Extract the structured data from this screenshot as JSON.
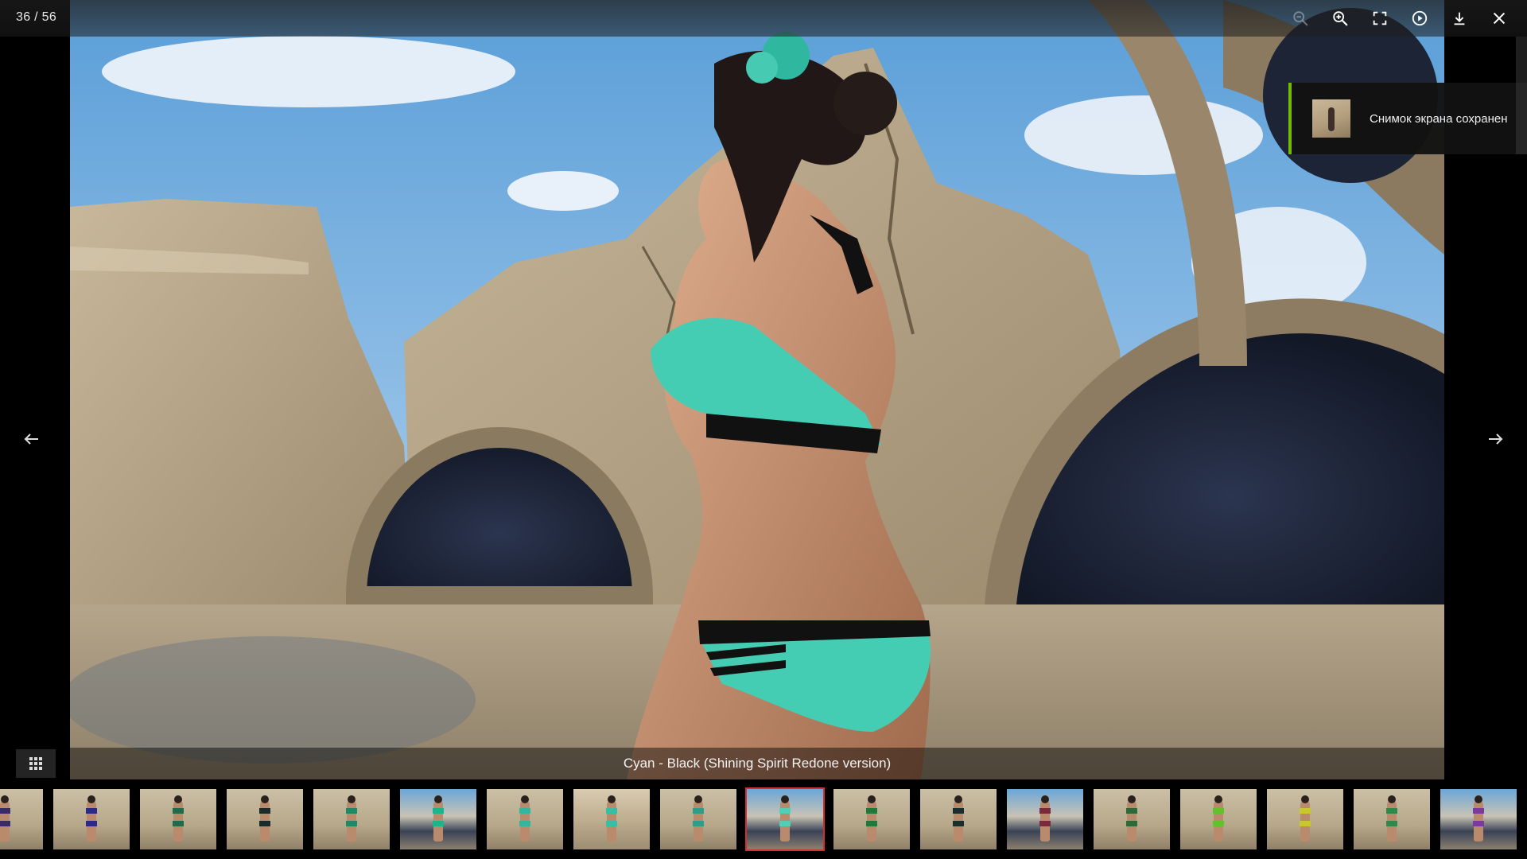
{
  "counter": {
    "current": 36,
    "total": 56,
    "text": "36 / 56"
  },
  "toolbar": {
    "items": [
      {
        "name": "zoom-out",
        "icon": "zoom-out-icon",
        "enabled": false
      },
      {
        "name": "zoom-in",
        "icon": "zoom-in-icon",
        "enabled": true
      },
      {
        "name": "fullscreen",
        "icon": "fullscreen-icon",
        "enabled": true
      },
      {
        "name": "slideshow",
        "icon": "play-circle-icon",
        "enabled": true
      },
      {
        "name": "download",
        "icon": "download-icon",
        "enabled": true
      },
      {
        "name": "close",
        "icon": "close-icon",
        "enabled": true
      }
    ]
  },
  "toast": {
    "text": "Снимок экрана сохранен",
    "accent": "#76b900"
  },
  "caption": "Cyan - Black (Shining Spirit Redone version)",
  "nav": {
    "prev_icon": "arrow-left-icon",
    "next_icon": "arrow-right-icon"
  },
  "grid_toggle_icon": "grid-icon",
  "thumbnails": {
    "active_index": 9,
    "active_color": "#d32f2f",
    "items": [
      {
        "bg": "desert",
        "suit": "#3a2a6a"
      },
      {
        "bg": "desert",
        "suit": "#2c2a88"
      },
      {
        "bg": "desert",
        "suit": "#1f6b4a"
      },
      {
        "bg": "desert",
        "suit": "#1b2b2b"
      },
      {
        "bg": "desert",
        "suit": "#1d8a66"
      },
      {
        "bg": "portal",
        "suit": "#20b28d"
      },
      {
        "bg": "desert",
        "suit": "#2fb7a0"
      },
      {
        "bg": "ruins",
        "suit": "#35c0a4"
      },
      {
        "bg": "desert",
        "suit": "#2c9f8a"
      },
      {
        "bg": "portal",
        "suit": "#4fd0b6"
      },
      {
        "bg": "desert",
        "suit": "#1d7a3a"
      },
      {
        "bg": "desert",
        "suit": "#1b2e2e"
      },
      {
        "bg": "portal",
        "suit": "#7a2a3a"
      },
      {
        "bg": "desert",
        "suit": "#2d6a3a"
      },
      {
        "bg": "desert",
        "suit": "#5fc42a"
      },
      {
        "bg": "desert",
        "suit": "#c8c82a"
      },
      {
        "bg": "desert",
        "suit": "#2e8a4a"
      },
      {
        "bg": "portal",
        "suit": "#7a3aa0"
      },
      {
        "bg": "ruins",
        "suit": "#c8b828"
      }
    ]
  }
}
